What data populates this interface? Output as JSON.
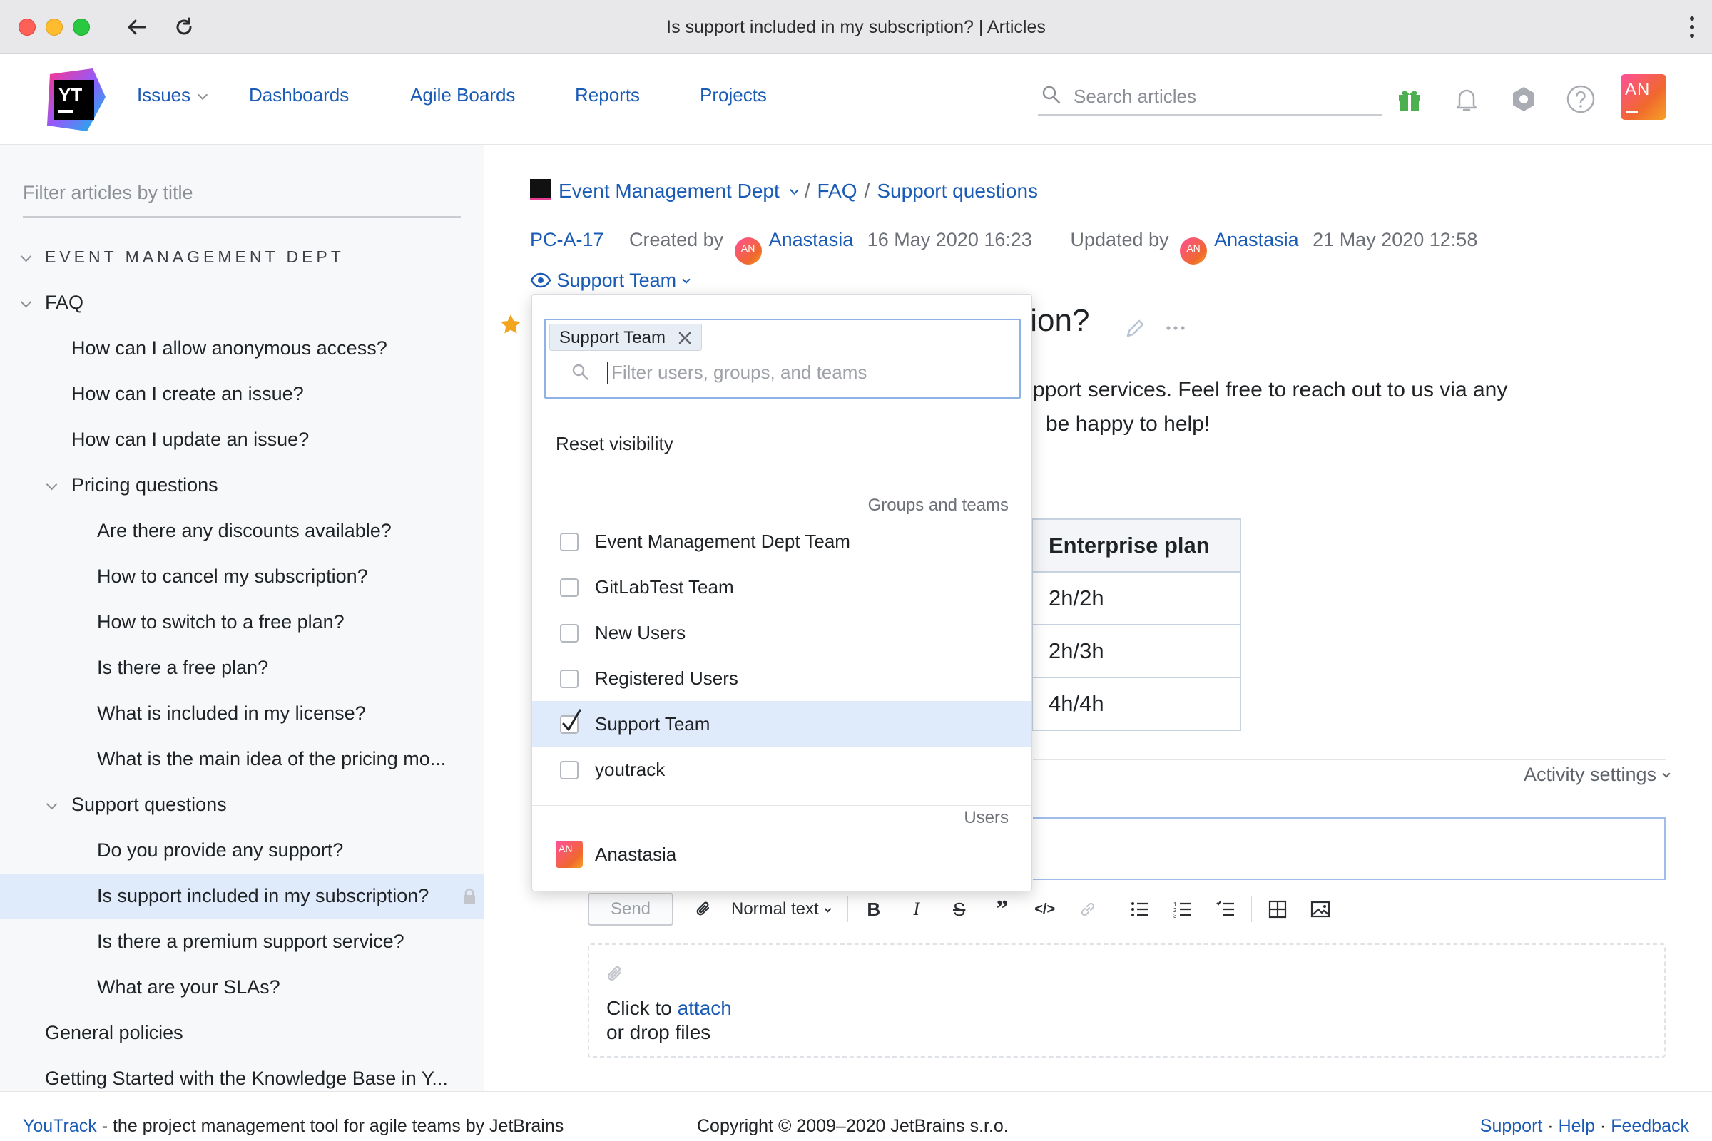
{
  "window": {
    "title": "Is support included in my subscription? | Articles"
  },
  "header": {
    "nav": [
      {
        "label": "Issues"
      },
      {
        "label": "Dashboards"
      },
      {
        "label": "Agile Boards"
      },
      {
        "label": "Reports"
      },
      {
        "label": "Projects"
      }
    ],
    "search_placeholder": "Search articles",
    "avatar_initials": "AN"
  },
  "sidebar": {
    "filter_placeholder": "Filter articles by title",
    "tree": [
      {
        "label": "EVENT MANAGEMENT DEPT",
        "level": 0,
        "kind": "section"
      },
      {
        "label": "FAQ",
        "level": 0,
        "kind": "folder"
      },
      {
        "label": "How can I allow anonymous access?",
        "level": 1
      },
      {
        "label": "How can I create an issue?",
        "level": 1
      },
      {
        "label": "How can I update an issue?",
        "level": 1
      },
      {
        "label": "Pricing questions",
        "level": 1,
        "kind": "folder"
      },
      {
        "label": "Are there any discounts available?",
        "level": 2
      },
      {
        "label": "How to cancel my subscription?",
        "level": 2
      },
      {
        "label": "How to switch to a free plan?",
        "level": 2
      },
      {
        "label": "Is there a free plan?",
        "level": 2
      },
      {
        "label": "What is included in my license?",
        "level": 2
      },
      {
        "label": "What is the main idea of the pricing mo...",
        "level": 2
      },
      {
        "label": "Support questions",
        "level": 1,
        "kind": "folder"
      },
      {
        "label": "Do you provide any support?",
        "level": 2
      },
      {
        "label": "Is support included in my subscription?",
        "level": 2,
        "selected": true,
        "locked": true
      },
      {
        "label": "Is there a premium support service?",
        "level": 2
      },
      {
        "label": "What are your SLAs?",
        "level": 2
      },
      {
        "label": "General policies",
        "level": 0
      },
      {
        "label": "Getting Started with the Knowledge Base in Y...",
        "level": 0
      }
    ]
  },
  "article": {
    "breadcrumb": {
      "project": "Event Management Dept",
      "folder": "FAQ",
      "parent": "Support questions"
    },
    "id": "PC-A-17",
    "created_label": "Created by",
    "created_by": "Anastasia",
    "created_at": "16 May 2020 16:23",
    "updated_label": "Updated by",
    "updated_by": "Anastasia",
    "updated_at": "21 May 2020 12:58",
    "author_initials": "AN",
    "visibility": "Support Team",
    "title_visible": "tion?",
    "para_line1": "pport services. Feel free to reach out to us via any",
    "para_line2": "be happy to help!",
    "table": {
      "header": "Enterprise plan",
      "rows": [
        "2h/2h",
        "2h/3h",
        "4h/4h"
      ]
    },
    "activity_settings": "Activity settings",
    "send_label": "Send",
    "text_style": "Normal text",
    "attach_line1_prefix": "Click to ",
    "attach_link": "attach",
    "attach_line2": "or drop files"
  },
  "visibility_popup": {
    "chip": "Support Team",
    "filter_placeholder": "Filter users, groups, and teams",
    "reset_label": "Reset visibility",
    "groups_heading": "Groups and teams",
    "groups": [
      {
        "label": "Event Management Dept Team",
        "checked": false
      },
      {
        "label": "GitLabTest Team",
        "checked": false
      },
      {
        "label": "New Users",
        "checked": false
      },
      {
        "label": "Registered Users",
        "checked": false
      },
      {
        "label": "Support Team",
        "checked": true
      },
      {
        "label": "youtrack",
        "checked": false
      }
    ],
    "users_heading": "Users",
    "users": [
      {
        "name": "Anastasia",
        "initials": "AN"
      }
    ]
  },
  "footer": {
    "brand_link": "YouTrack",
    "tagline": " - the project management tool for agile teams by JetBrains",
    "copyright": "Copyright © 2009–2020 JetBrains s.r.o.",
    "links": [
      "Support",
      "Help",
      "Feedback"
    ]
  },
  "colors": {
    "link": "#1a5bb5",
    "selected_row": "#dfeafb",
    "accent_star": "#f2a51f"
  }
}
